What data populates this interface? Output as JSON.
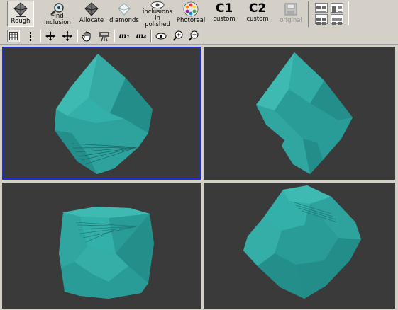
{
  "toolbar": {
    "buttons": [
      {
        "id": "rough",
        "label": "Rough",
        "icon": "rough-diamond-icon",
        "pressed": true
      },
      {
        "id": "find_inclusion",
        "label": "Find\nInclusion",
        "icon": "magnifier-inclusion-icon"
      },
      {
        "id": "allocate",
        "label": "Allocate",
        "icon": "allocate-diamond-icon"
      },
      {
        "id": "diamonds",
        "label": "diamonds",
        "icon": "diamond-outline-icon"
      },
      {
        "id": "inclusions_in_polished",
        "label": "inclusions\nin polished",
        "icon": "eye-icon"
      },
      {
        "id": "photoreal",
        "label": "Photoreal",
        "icon": "color-wheel-icon"
      },
      {
        "id": "custom1",
        "big": "C1",
        "label": "custom"
      },
      {
        "id": "custom2",
        "big": "C2",
        "label": "custom"
      },
      {
        "id": "original",
        "label": "original",
        "icon": "floppy-disk-icon",
        "disabled": true
      }
    ]
  },
  "toolbar2": {
    "tools": [
      "grid-view-icon",
      "vertical-dots-icon",
      "move-icon",
      "pan-cross-icon",
      "hand-icon",
      "projector-icon",
      "measure-m1-icon",
      "measure-m4-icon",
      "eye-view-icon",
      "zoom-in-icon",
      "zoom-out-icon"
    ],
    "m1_label": "m₁",
    "m4_label": "m₄"
  },
  "viewports": {
    "count": 4,
    "active": "top-left",
    "background": "#3a3a3a",
    "stone_color": "#2a9c97"
  }
}
